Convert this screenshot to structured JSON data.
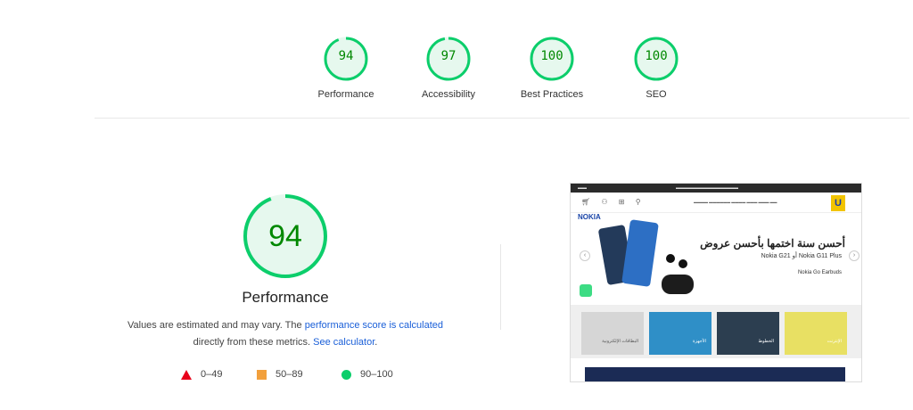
{
  "gauges": [
    {
      "score": "94",
      "label": "Performance",
      "value": 94
    },
    {
      "score": "97",
      "label": "Accessibility",
      "value": 97
    },
    {
      "score": "100",
      "label": "Best Practices",
      "value": 100
    },
    {
      "score": "100",
      "label": "SEO",
      "value": 100
    }
  ],
  "main": {
    "score": "94",
    "value": 94,
    "title": "Performance",
    "desc_prefix": "Values are estimated and may vary. The ",
    "desc_link1": "performance score is calculated",
    "desc_middle": "directly from these metrics. ",
    "desc_link2": "See calculator",
    "desc_suffix": "."
  },
  "legend": [
    {
      "shape": "triangle",
      "range": "0–49",
      "color": "#e8001a"
    },
    {
      "shape": "square",
      "range": "50–89",
      "color": "#f2a03c"
    },
    {
      "shape": "circle",
      "range": "90–100",
      "color": "#0cce6b"
    }
  ],
  "colors": {
    "pass": "#0cce6b",
    "pass_text": "#008800",
    "pass_fill": "#e6f8ee",
    "link": "#1a5fd8"
  },
  "screenshot": {
    "brand": "NOKIA",
    "logo": "U",
    "hero_title": "أحسن سنة اختمها بأحسن عروض",
    "hero_sub": "Nokia G11 Plus أو Nokia G21",
    "hero_sub2": "Nokia Go Earbuds",
    "categories": [
      "الإنترنت",
      "الخطوط",
      "الأجهزة",
      "البطاقات الإلكترونية"
    ]
  }
}
